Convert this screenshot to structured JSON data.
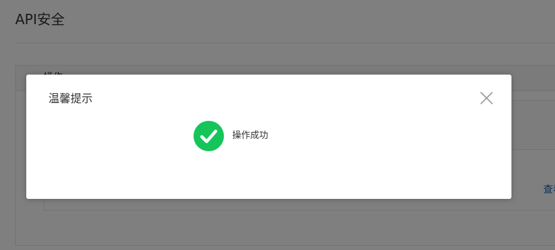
{
  "page": {
    "title": "API安全",
    "panel_header_label": "操作",
    "view_link": "查看"
  },
  "dialog": {
    "title": "温馨提示",
    "close_icon": "close-icon",
    "status_icon": "check-circle-icon",
    "message": "操作成功"
  },
  "colors": {
    "success": "#15c55a",
    "mask": "rgba(0,0,0,0.5)",
    "link": "#1a5fb4"
  }
}
